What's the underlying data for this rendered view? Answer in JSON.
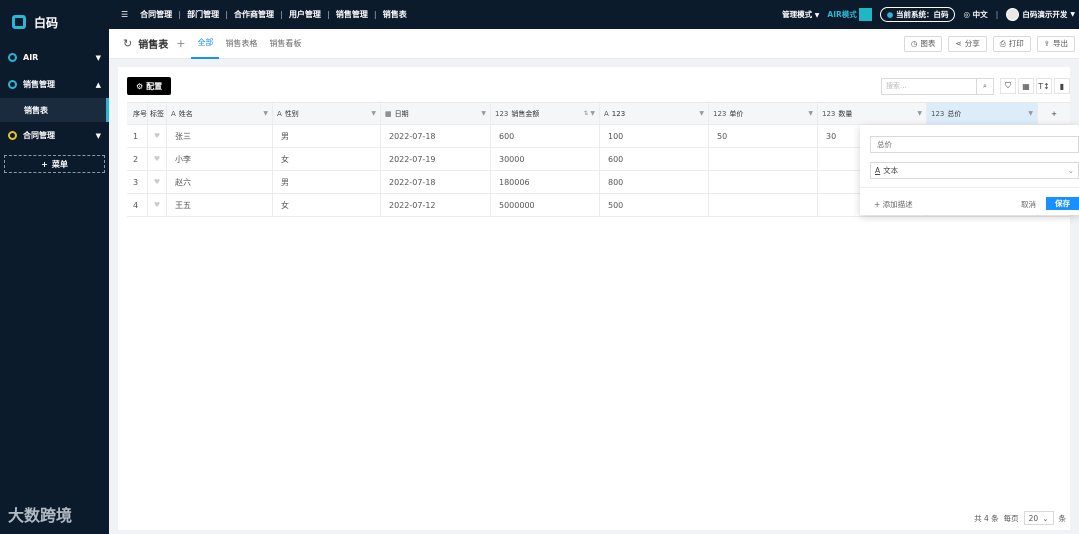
{
  "brand": {
    "name": "白码"
  },
  "sidebar": {
    "items": [
      {
        "label": "AIR"
      },
      {
        "label": "销售管理"
      },
      {
        "label": "合同管理"
      }
    ],
    "sub_active": "销售表",
    "add_menu": "菜单",
    "add_symbol": "+"
  },
  "watermark": "大数跨境",
  "topbar": {
    "nav": [
      "合同管理",
      "部门管理",
      "合作商管理",
      "用户管理",
      "销售管理",
      "销售表"
    ],
    "mode": "管理模式",
    "air_mode": "AIR模式",
    "current_system": "当前系统：白码",
    "language": "中文",
    "user": "白码演示开发"
  },
  "tabbar": {
    "title": "销售表",
    "tabs": [
      "全部",
      "销售表格",
      "销售看板"
    ],
    "actions": [
      "图表",
      "分享",
      "打印",
      "导出"
    ]
  },
  "toolbar": {
    "config_label": "配置",
    "search_placeholder": "搜索..."
  },
  "table": {
    "headers": [
      {
        "icon": "",
        "label": "序号"
      },
      {
        "icon": "",
        "label": "标签"
      },
      {
        "icon": "A",
        "label": "姓名"
      },
      {
        "icon": "A",
        "label": "性别"
      },
      {
        "icon": "▦",
        "label": "日期"
      },
      {
        "icon": "123",
        "label": "销售金额"
      },
      {
        "icon": "A",
        "label": "123"
      },
      {
        "icon": "123",
        "label": "单价"
      },
      {
        "icon": "123",
        "label": "数量"
      },
      {
        "icon": "123",
        "label": "总价"
      },
      {
        "icon": "",
        "label": "+"
      }
    ],
    "rows": [
      {
        "index": "1",
        "name": "张三",
        "gender": "男",
        "date": "2022-07-18",
        "amount": "600",
        "v123": "100",
        "price": "50",
        "qty": "30",
        "total": ""
      },
      {
        "index": "2",
        "name": "小李",
        "gender": "女",
        "date": "2022-07-19",
        "amount": "30000",
        "v123": "600",
        "price": "",
        "qty": "",
        "total": ""
      },
      {
        "index": "3",
        "name": "赵六",
        "gender": "男",
        "date": "2022-07-18",
        "amount": "180006",
        "v123": "800",
        "price": "",
        "qty": "",
        "total": ""
      },
      {
        "index": "4",
        "name": "王五",
        "gender": "女",
        "date": "2022-07-12",
        "amount": "5000000",
        "v123": "500",
        "price": "",
        "qty": "",
        "total": ""
      }
    ]
  },
  "popover": {
    "field_name": "总价",
    "field_type": "文本",
    "add_desc": "+ 添加描述",
    "cancel": "取消",
    "save": "保存"
  },
  "pagination": {
    "total": "共 4 条",
    "per_page_label": "每页",
    "page_size": "20",
    "unit": "条"
  }
}
